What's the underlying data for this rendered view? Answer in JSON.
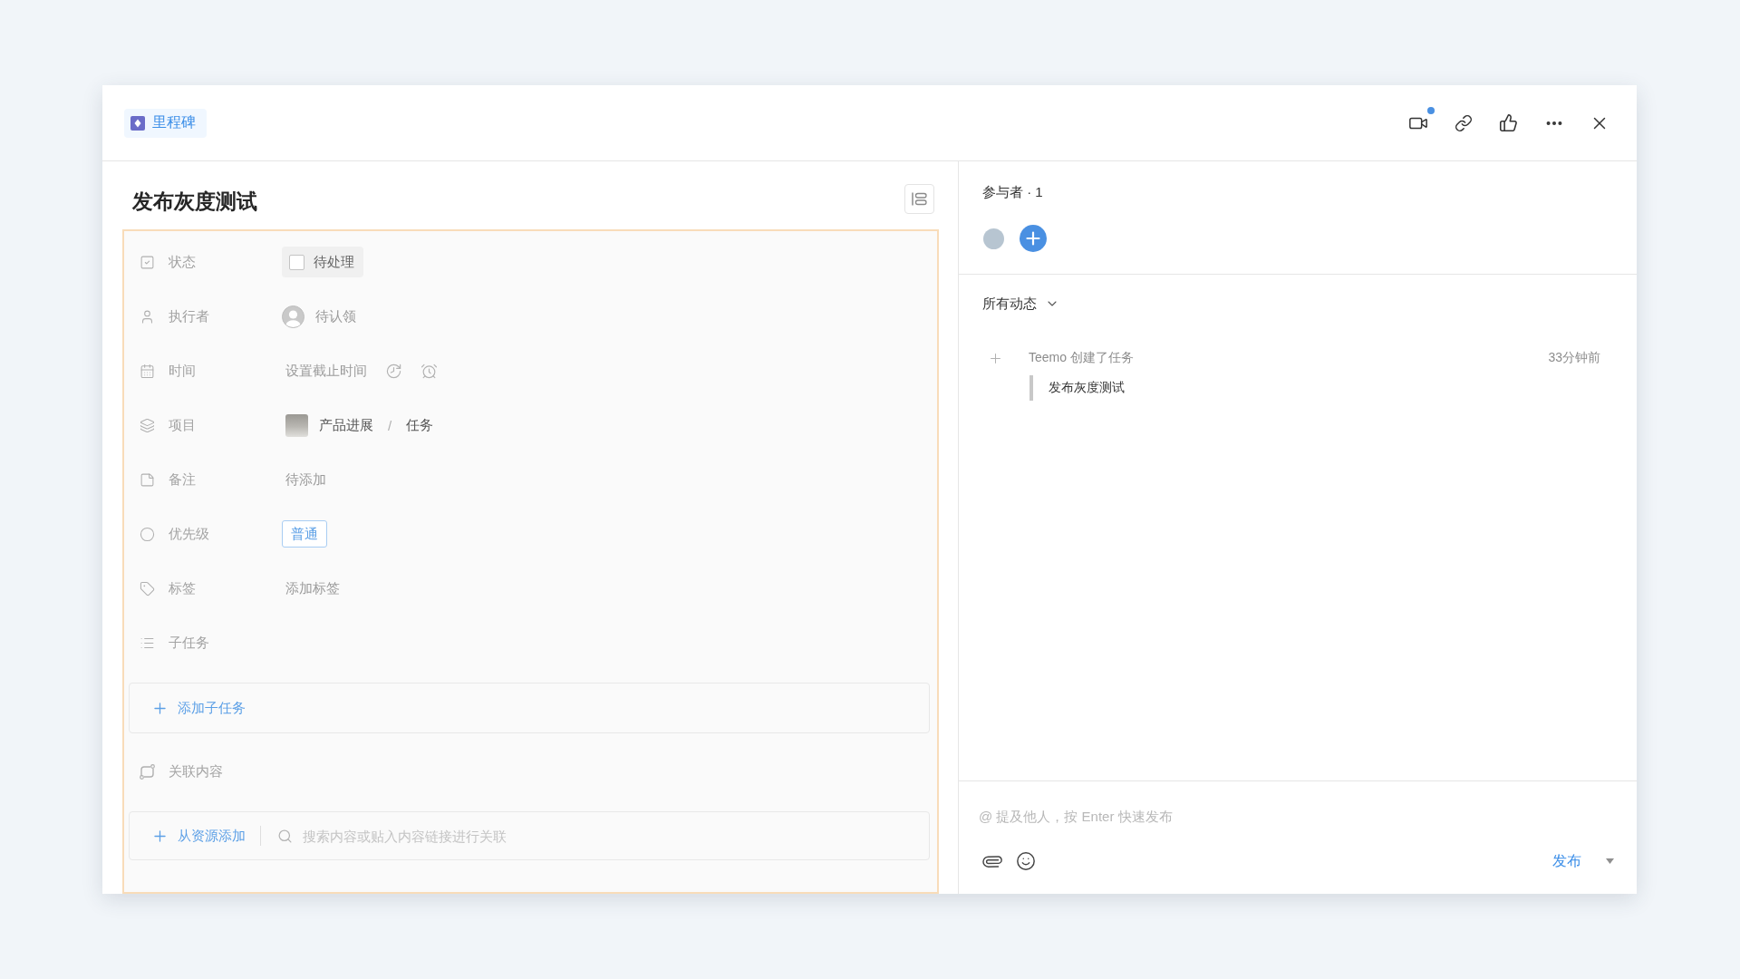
{
  "header": {
    "tag": "里程碑",
    "camera_notice": true
  },
  "task": {
    "title": "发布灰度测试",
    "fields": [
      {
        "kind": "status",
        "label": "状态",
        "value": "待处理",
        "checked": false
      },
      {
        "kind": "assignee",
        "label": "执行者",
        "value": "待认领"
      },
      {
        "kind": "time",
        "label": "时间",
        "value": "设置截止时间"
      },
      {
        "kind": "project",
        "label": "项目",
        "project": "产品进展",
        "separator": "/",
        "list": "任务"
      },
      {
        "kind": "note",
        "label": "备注",
        "value": "待添加"
      },
      {
        "kind": "priority",
        "label": "优先级",
        "value": "普通"
      },
      {
        "kind": "tags",
        "label": "标签",
        "value": "添加标签"
      }
    ],
    "subtasks": {
      "label": "子任务",
      "add_button": "添加子任务"
    },
    "related": {
      "label": "关联内容",
      "add_button": "从资源添加",
      "search_placeholder": "搜索内容或贴入内容链接进行关联"
    }
  },
  "participants": {
    "title": "参与者 · 1"
  },
  "activity": {
    "filter": "所有动态",
    "entries": [
      {
        "text": "Teemo 创建了任务",
        "time": "33分钟前",
        "quote": "发布灰度测试"
      }
    ]
  },
  "composer": {
    "placeholder": "@ 提及他人，按 Enter 快速发布",
    "submit": "发布"
  }
}
